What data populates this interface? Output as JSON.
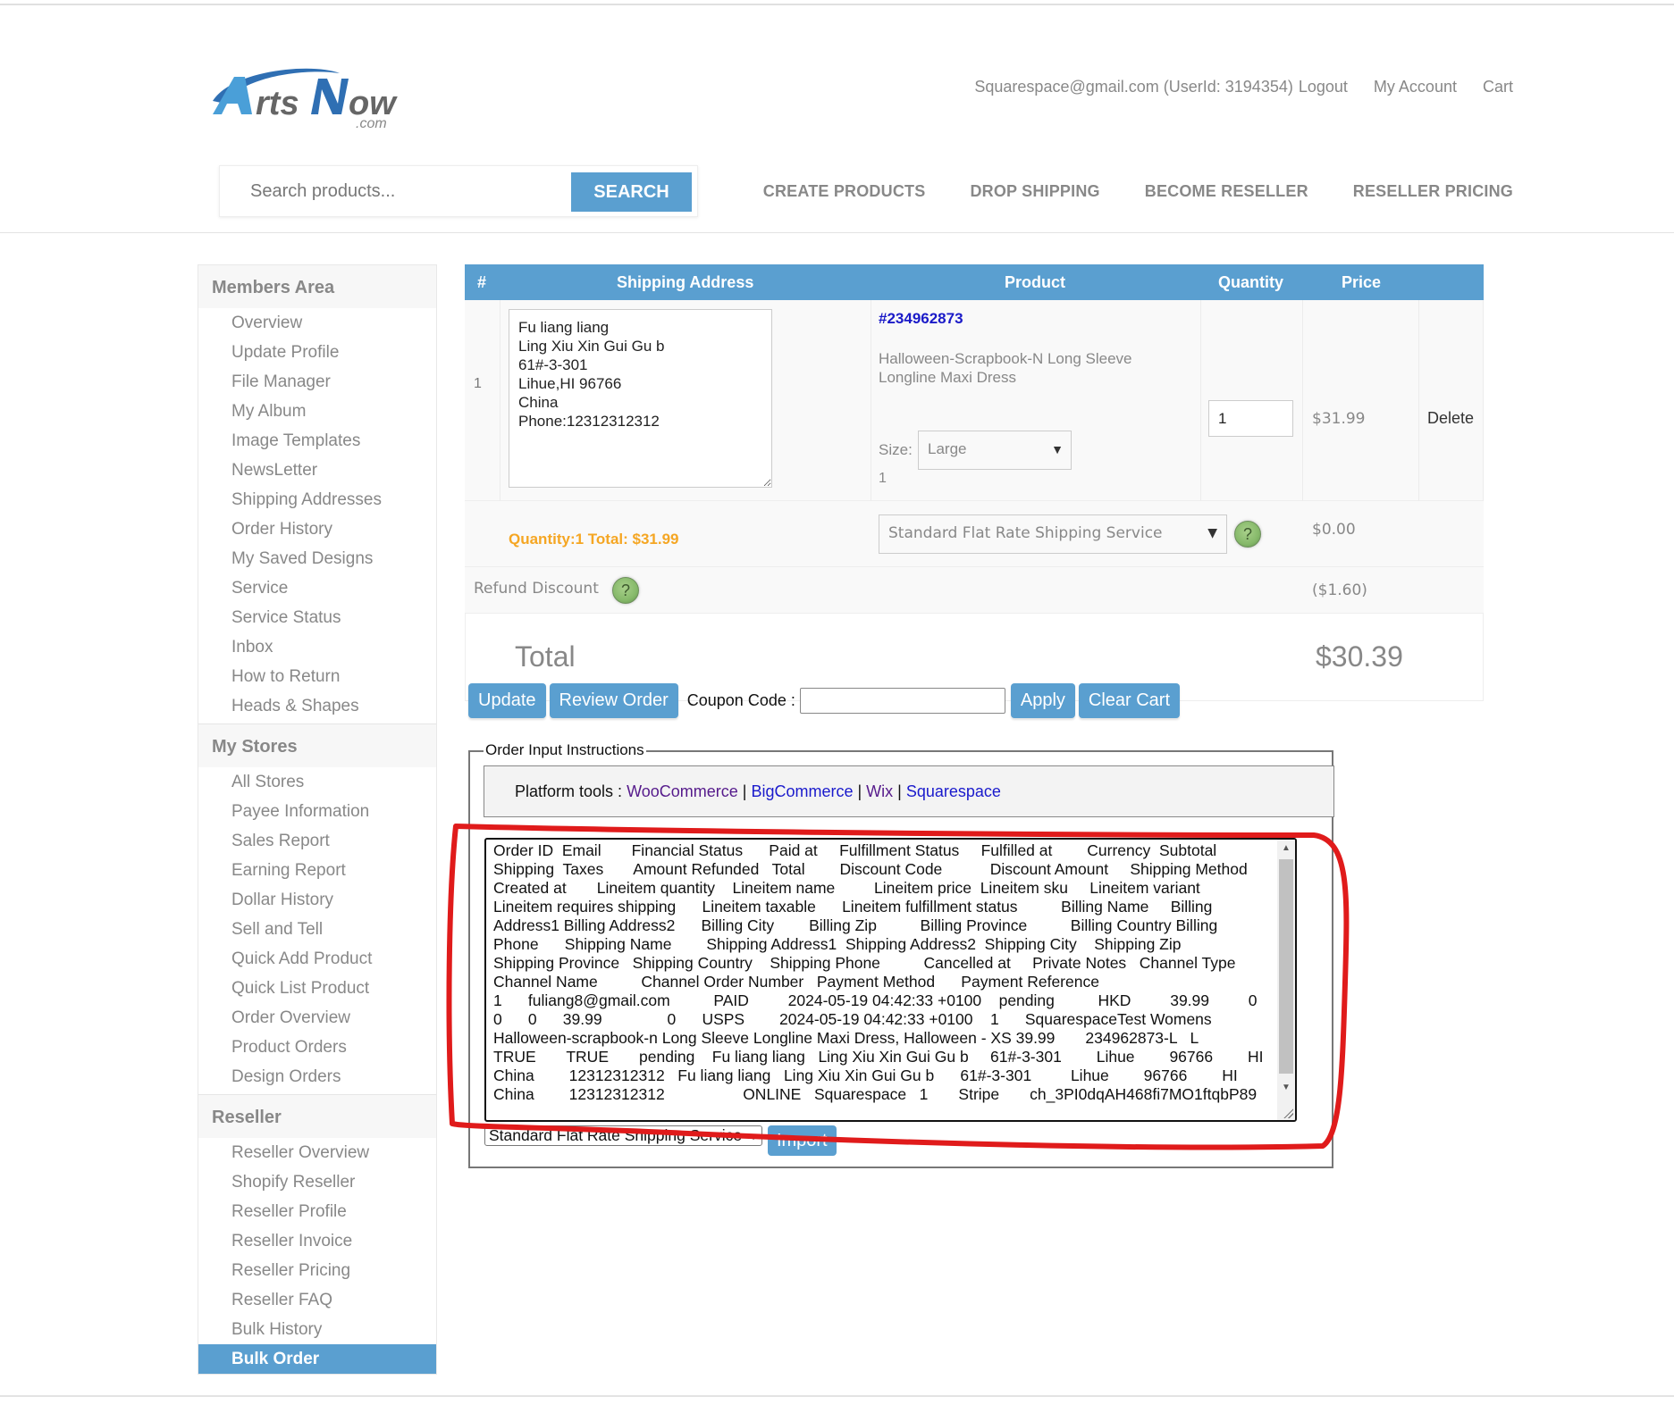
{
  "header": {
    "logo_text": "ArtsNow",
    "logo_sub": ".com",
    "user_info": "Squarespace@gmail.com (UserId: 3194354)",
    "logout": "Logout",
    "my_account": "My Account",
    "cart": "Cart",
    "search_placeholder": "Search products...",
    "search_button": "SEARCH",
    "nav": [
      "CREATE PRODUCTS",
      "DROP SHIPPING",
      "BECOME RESELLER",
      "RESELLER PRICING"
    ]
  },
  "sidebar": {
    "sections": [
      {
        "title": "Members Area",
        "items": [
          "Overview",
          "Update Profile",
          "File Manager",
          "My Album",
          "Image Templates",
          "NewsLetter",
          "Shipping Addresses",
          "Order History",
          "My Saved Designs",
          "Service",
          "Service Status",
          "Inbox",
          "How to Return",
          "Heads & Shapes"
        ]
      },
      {
        "title": "My Stores",
        "items": [
          "All Stores",
          "Payee Information",
          "Sales Report",
          "Earning Report",
          "Dollar History",
          "Sell and Tell",
          "Quick Add Product",
          "Quick List Product",
          "Order Overview",
          "Product Orders",
          "Design Orders"
        ]
      },
      {
        "title": "Reseller",
        "items": [
          "Reseller Overview",
          "Shopify Reseller",
          "Reseller Profile",
          "Reseller Invoice",
          "Reseller Pricing",
          "Reseller FAQ",
          "Bulk History",
          "Bulk Order"
        ]
      }
    ],
    "active_item": "Bulk Order"
  },
  "cart": {
    "columns": [
      "#",
      "Shipping Address",
      "Product",
      "Quantity",
      "Price"
    ],
    "rows": [
      {
        "num": "1",
        "address": "Fu liang liang\nLing Xiu Xin Gui Gu b\n61#-3-301\nLihue,HI 96766\nChina\nPhone:12312312312",
        "summary": "Quantity:1 Total: $31.99",
        "product_id": "#234962873",
        "product_name": "Halloween-Scrapbook-N Long Sleeve Longline Maxi Dress",
        "size_label": "Size:",
        "size_value": "Large",
        "product_qty_note": "1",
        "quantity": "1",
        "price": "$31.99",
        "delete": "Delete",
        "shipping_service": "Standard Flat Rate Shipping Service",
        "shipping_price": "$0.00"
      }
    ],
    "refund_label": "Refund Discount",
    "refund_value": "($1.60)",
    "total_label": "Total",
    "total_value": "$30.39"
  },
  "actions": {
    "update": "Update",
    "review_order": "Review Order",
    "coupon_label": "Coupon Code :",
    "coupon_value": "",
    "apply": "Apply",
    "clear_cart": "Clear Cart"
  },
  "order_input": {
    "legend": "Order Input Instructions",
    "platform_label": "Platform tools :",
    "platforms": [
      "WooCommerce",
      "BigCommerce",
      "Wix",
      "Squarespace"
    ],
    "csv_lines": [
      "Order ID  Email       Financial Status      Paid at     Fulfillment Status     Fulfilled at        Currency  Subtotal",
      "Shipping  Taxes       Amount Refunded   Total        Discount Code           Discount Amount     Shipping Method",
      "Created at       Lineitem quantity    Lineitem name         Lineitem price  Lineitem sku     Lineitem variant",
      "Lineitem requires shipping      Lineitem taxable      Lineitem fulfillment status          Billing Name     Billing",
      "Address1 Billing Address2      Billing City        Billing Zip          Billing Province          Billing Country Billing",
      "Phone      Shipping Name        Shipping Address1  Shipping Address2  Shipping City    Shipping Zip",
      "Shipping Province   Shipping Country    Shipping Phone          Cancelled at     Private Notes   Channel Type",
      "Channel Name          Channel Order Number   Payment Method      Payment Reference",
      "1      fuliang8@gmail.com          PAID         2024-05-19 04:42:33 +0100    pending          HKD         39.99         0",
      "0      0      39.99               0      USPS        2024-05-19 04:42:33 +0100    1      SquarespaceTest Womens",
      "Halloween-scrapbook-n Long Sleeve Longline Maxi Dress, Halloween - XS 39.99       234962873-L   L",
      "TRUE       TRUE       pending    Fu liang liang   Ling Xiu Xin Gui Gu b     61#-3-301        Lihue        96766        HI",
      "China        12312312312   Fu liang liang   Ling Xiu Xin Gui Gu b      61#-3-301         Lihue        96766        HI",
      "China        12312312312                  ONLINE   Squarespace   1       Stripe       ch_3PI0dqAH468fi7MO1ftqbP89"
    ],
    "shipping_option": "Standard Flat Rate Shipping Service",
    "import_button": "Import"
  },
  "colors": {
    "accent": "#5a9fd0",
    "summary_orange": "#f5a623",
    "annotation_red": "#e01b1b",
    "link_blue": "#1a1acc",
    "link_visited": "#551a8b"
  }
}
